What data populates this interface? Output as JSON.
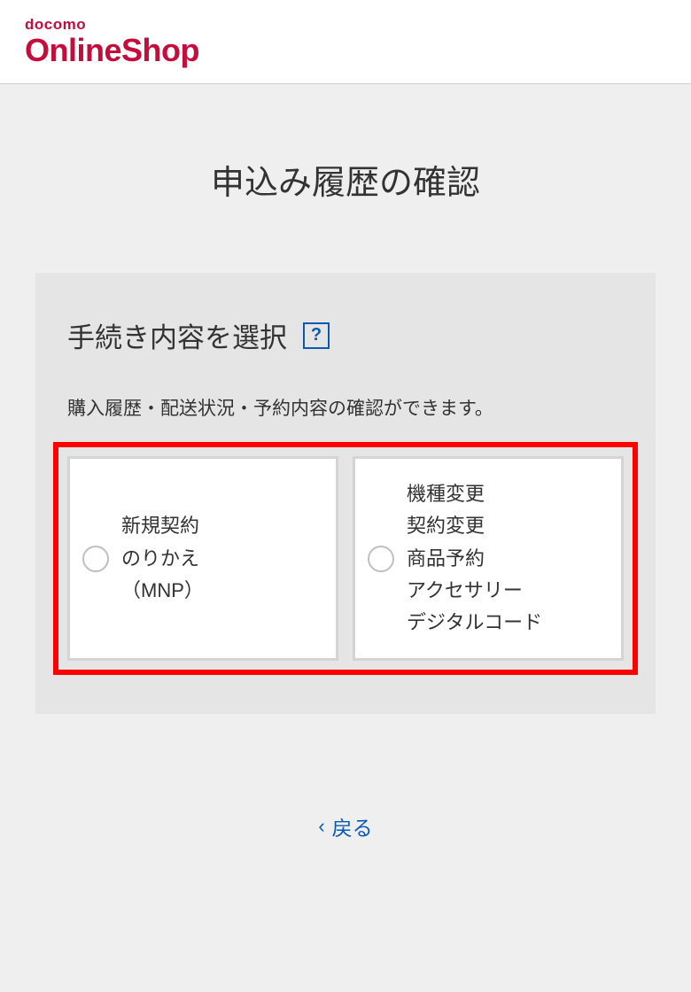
{
  "header": {
    "logo_top": "docomo",
    "logo_main": "OnlineShop"
  },
  "page": {
    "title": "申込み履歴の確認"
  },
  "panel": {
    "title": "手続き内容を選択",
    "help_symbol": "?",
    "description": "購入履歴・配送状況・予約内容の確認ができます。"
  },
  "options": [
    {
      "label": "新規契約\nのりかえ\n（MNP）"
    },
    {
      "label": "機種変更\n契約変更\n商品予約\nアクセサリー\nデジタルコード"
    }
  ],
  "back": {
    "chevron": "‹",
    "label": "戻る"
  }
}
